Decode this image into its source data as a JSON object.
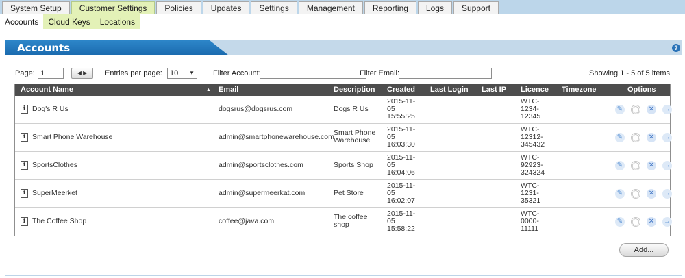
{
  "nav": {
    "tabs": [
      "System Setup",
      "Customer Settings",
      "Policies",
      "Updates",
      "Settings",
      "Management",
      "Reporting",
      "Logs",
      "Support"
    ],
    "active_tab": "Customer Settings",
    "subnav": [
      "Accounts",
      "Cloud Keys",
      "Locations"
    ]
  },
  "panel": {
    "title": "Accounts",
    "help_icon": "?"
  },
  "controls": {
    "page_label": "Page:",
    "page_value": "1",
    "pager_arrows": "◀ ▶",
    "entries_label": "Entries per page:",
    "entries_value": "10",
    "filter_account_label": "Filter Account:",
    "filter_account_value": "",
    "filter_email_label": "Filter Email:",
    "filter_email_value": "",
    "showing": "Showing 1 - 5 of 5 items"
  },
  "table": {
    "columns": [
      "Account Name",
      "Email",
      "Description",
      "Created",
      "Last Login",
      "Last IP",
      "Licence",
      "Timezone",
      "Options"
    ],
    "sort_indicator": "▲",
    "rows": [
      {
        "name": "Dog's R Us",
        "email": "dogsrus@dogsrus.com",
        "description": [
          "Dogs R Us"
        ],
        "created": [
          "2015-11-",
          "05",
          "15:55:25"
        ],
        "last_login": "",
        "last_ip": "",
        "licence": [
          "WTC-",
          "1234-",
          "12345"
        ],
        "timezone": ""
      },
      {
        "name": "Smart Phone Warehouse",
        "email": "admin@smartphonewarehouse.com",
        "description": [
          "Smart Phone",
          "Warehouse"
        ],
        "created": [
          "2015-11-",
          "05",
          "16:03:30"
        ],
        "last_login": "",
        "last_ip": "",
        "licence": [
          "WTC-",
          "12312-",
          "345432"
        ],
        "timezone": ""
      },
      {
        "name": "SportsClothes",
        "email": "admin@sportsclothes.com",
        "description": [
          "Sports Shop"
        ],
        "created": [
          "2015-11-",
          "05",
          "16:04:06"
        ],
        "last_login": "",
        "last_ip": "",
        "licence": [
          "WTC-",
          "92923-",
          "324324"
        ],
        "timezone": ""
      },
      {
        "name": "SuperMeerket",
        "email": "admin@supermeerkat.com",
        "description": [
          "Pet Store"
        ],
        "created": [
          "2015-11-",
          "05",
          "16:02:07"
        ],
        "last_login": "",
        "last_ip": "",
        "licence": [
          "WTC-",
          "1231-",
          "35321"
        ],
        "timezone": ""
      },
      {
        "name": "The Coffee Shop",
        "email": "coffee@java.com",
        "description": [
          "The coffee",
          "shop"
        ],
        "created": [
          "2015-11-",
          "05",
          "15:58:22"
        ],
        "last_login": "",
        "last_ip": "",
        "licence": [
          "WTC-",
          "0000-",
          "11111"
        ],
        "timezone": ""
      }
    ],
    "option_icons": [
      "edit-icon",
      "user-icon",
      "delete-icon",
      "go-icon"
    ]
  },
  "add_button": "Add...",
  "colors": {
    "header_blue": "#1a6aae",
    "active_tab": "#e3f1b7",
    "grid_header": "#4d4d4d",
    "topbar": "#bcd6ea"
  }
}
